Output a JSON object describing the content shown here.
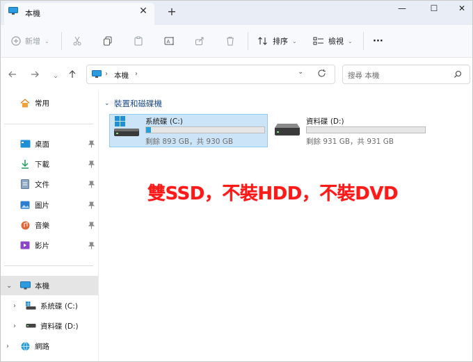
{
  "window": {
    "tab_title": "本機",
    "tab_close": "✕",
    "new_tab": "+",
    "minimize": "—",
    "maximize": "☐",
    "close": "✕"
  },
  "toolbar": {
    "new_label": "新增",
    "sort_label": "排序",
    "view_label": "檢視",
    "more_label": "···"
  },
  "address": {
    "path": "本機",
    "search_placeholder": "搜尋 本機"
  },
  "sidebar": {
    "home": "常用",
    "quick": [
      {
        "label": "桌面"
      },
      {
        "label": "下載"
      },
      {
        "label": "文件"
      },
      {
        "label": "圖片"
      },
      {
        "label": "音樂"
      },
      {
        "label": "影片"
      }
    ],
    "this_pc": "本機",
    "drives": [
      {
        "label": "系統碟 (C:)"
      },
      {
        "label": "資料碟 (D:)"
      }
    ],
    "network": "網路"
  },
  "content": {
    "group_title": "裝置和磁碟機",
    "drives": [
      {
        "name": "系統碟 (C:)",
        "meta": "剩餘 893 GB，共 930 GB",
        "used_fraction": 0.04
      },
      {
        "name": "資料碟 (D:)",
        "meta": "剩餘 931 GB，共 931 GB",
        "used_fraction": 0.0
      }
    ]
  },
  "annotation": "雙SSD，不裝HDD，不裝DVD",
  "colors": {
    "accent": "#26a0da",
    "selection": "#cce4f7",
    "annotation": "#ff1a1a"
  }
}
